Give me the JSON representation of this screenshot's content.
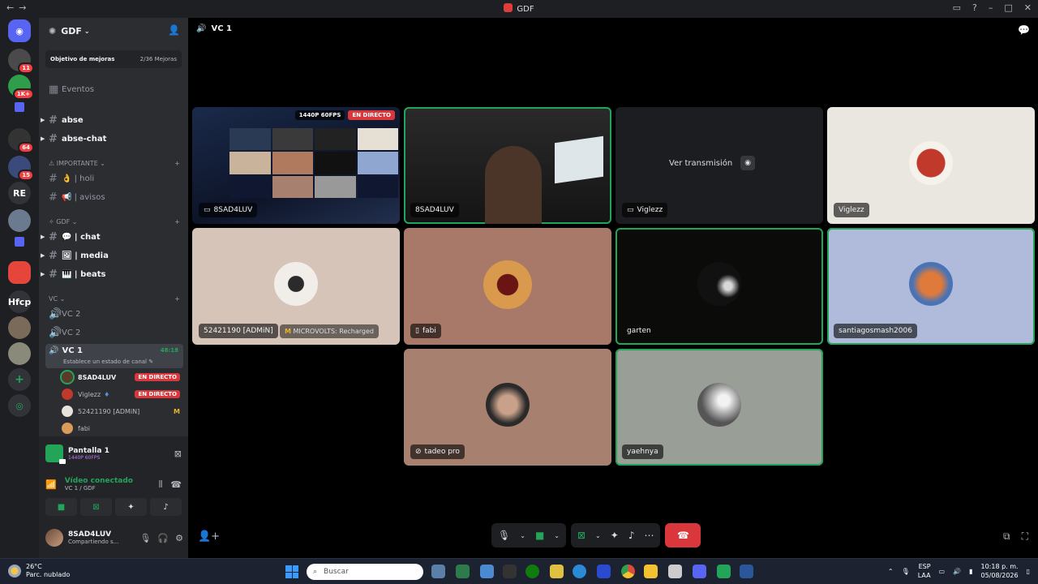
{
  "titlebar": {
    "title": "GDF"
  },
  "rail": {
    "badges": [
      "11",
      "1K+",
      "64",
      "15"
    ],
    "labels": [
      "RE",
      "Hfcp"
    ]
  },
  "guild": {
    "name": "GDF"
  },
  "boost": {
    "label": "Objetivo de mejoras",
    "progress": "2/36 Mejoras"
  },
  "events": {
    "label": "Eventos"
  },
  "channels": {
    "abse": "abse",
    "abse_chat": "abse-chat",
    "cat_importante": "IMPORTANTE",
    "holi": "👌 | holi",
    "avisos": "📢 | avisos",
    "cat_gdf": "GDF",
    "chat": "💬 | chat",
    "media": "🖼 | media",
    "beats": "🎹 | beats",
    "cat_vc": "VC",
    "vc2a": "VC 2",
    "vc2b": "VC 2",
    "vc1": "VC 1",
    "vc1_time": "48:18",
    "vc1_status": "Establece un estado de canal"
  },
  "voice_users": [
    {
      "name": "8SAD4LUV",
      "live": "EN DIRECTO"
    },
    {
      "name": "Viglezz",
      "live": "EN DIRECTO"
    },
    {
      "name": "52421190 [ADMiN]"
    },
    {
      "name": "fabi"
    }
  ],
  "panel": {
    "screen_title": "Pantalla 1",
    "screen_sub": "1440P 60FPS",
    "voice_title": "Vídeo conectado",
    "voice_sub": "VC 1 / GDF",
    "user_name": "8SAD4LUV",
    "user_status": "Compartiendo s..."
  },
  "stage": {
    "channel": "VC 1"
  },
  "tiles": [
    {
      "name": "8SAD4LUV",
      "quality": "1440P 60FPS",
      "live": "EN DIRECTO"
    },
    {
      "name": "8SAD4LUV"
    },
    {
      "name": "Viglezz",
      "watch": "Ver transmisión"
    },
    {
      "name": "Viglezz"
    },
    {
      "name": "52421190 [ADMiN]",
      "activity": "MICROVOLTS: Recharged"
    },
    {
      "name": "fabi"
    },
    {
      "name": "garten"
    },
    {
      "name": "santiagosmash2006"
    },
    {
      "name": "tadeo pro"
    },
    {
      "name": "yaehnya"
    }
  ],
  "taskbar": {
    "temp": "26°C",
    "weather": "Parc. nublado",
    "search_placeholder": "Buscar",
    "lang": "ESP",
    "lang2": "LAA",
    "time": "10:18 p. m.",
    "date": "05/08/2026"
  },
  "colors": {
    "accent": "#5865f2",
    "live": "#da373c",
    "speaking": "#23a559"
  }
}
